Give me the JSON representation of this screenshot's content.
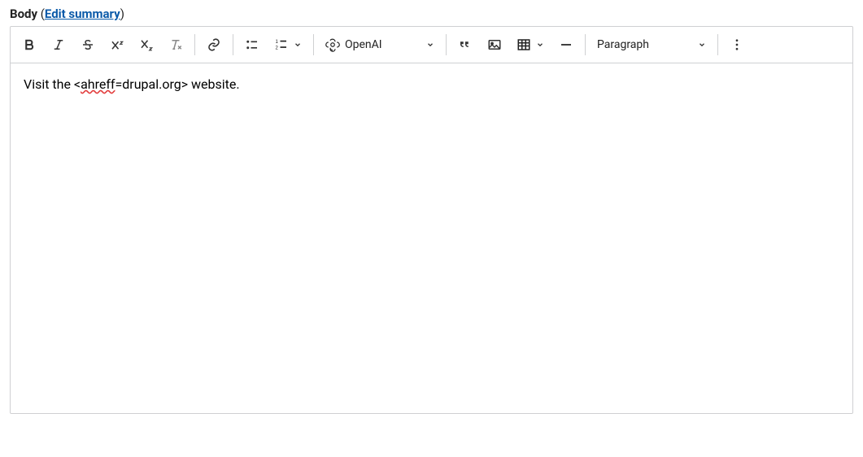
{
  "field": {
    "label": "Body",
    "edit_summary": "Edit summary",
    "paren_open": " (",
    "paren_close": ")"
  },
  "toolbar": {
    "openai_label": "OpenAI",
    "paragraph_label": "Paragraph",
    "icons": {
      "bold": "bold-icon",
      "italic": "italic-icon",
      "strike": "strikethrough-icon",
      "sup": "superscript-icon",
      "sub": "subscript-icon",
      "removefmt": "remove-format-icon",
      "link": "link-icon",
      "ul": "bulleted-list-icon",
      "ol": "numbered-list-icon",
      "quote": "blockquote-icon",
      "image": "image-icon",
      "table": "table-icon",
      "hr": "horizontal-line-icon",
      "more": "more-options-icon",
      "openai": "openai-icon"
    }
  },
  "content": {
    "prefix": "Visit the <",
    "misspelled": "ahreff",
    "suffix": "=drupal.org> website."
  }
}
